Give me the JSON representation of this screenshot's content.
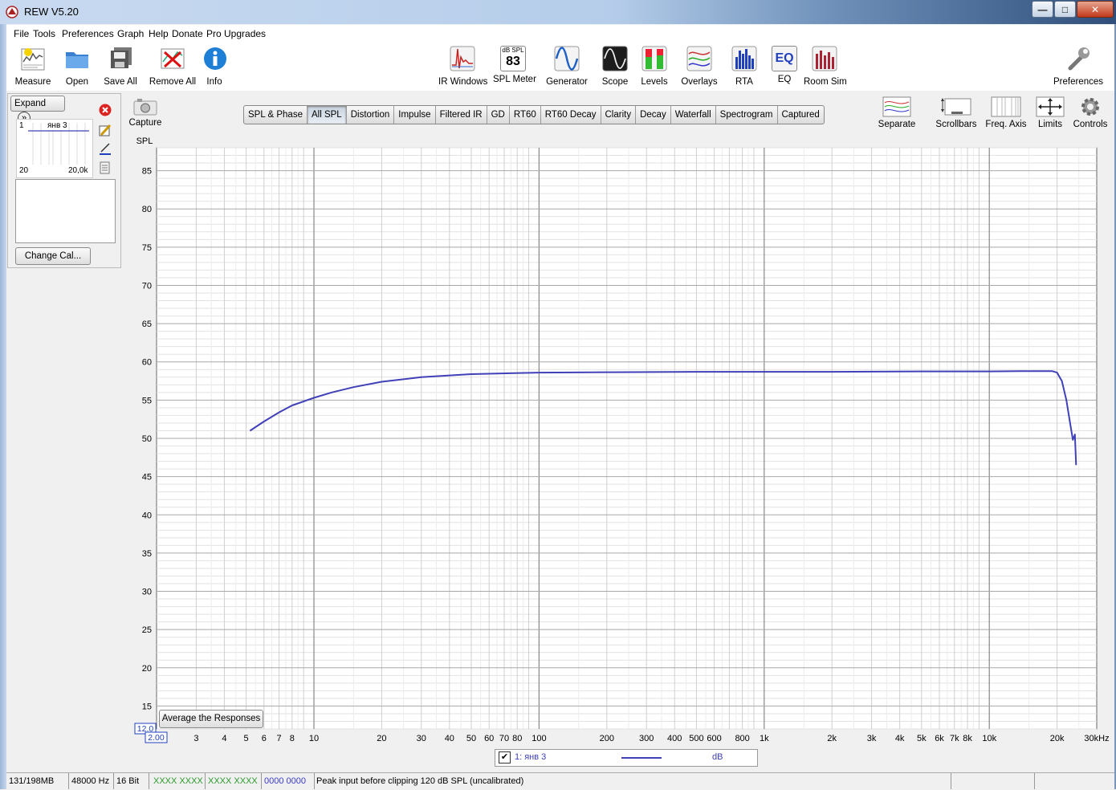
{
  "window": {
    "title": "REW V5.20",
    "minimize_glyph": "—",
    "maximize_glyph": "□",
    "close_glyph": "✕"
  },
  "menu": [
    "File",
    "Tools",
    "Preferences",
    "Graph",
    "Help",
    "Donate",
    "Pro Upgrades"
  ],
  "toolbar_left": [
    {
      "label": "Measure",
      "icon": "measure-icon"
    },
    {
      "label": "Open",
      "icon": "folder-icon"
    },
    {
      "label": "Save All",
      "icon": "save-all-icon"
    },
    {
      "label": "Remove All",
      "icon": "remove-all-icon"
    },
    {
      "label": "Info",
      "icon": "info-icon"
    }
  ],
  "toolbar_center": [
    {
      "label": "IR Windows",
      "icon": "ir-windows-icon"
    },
    {
      "label": "SPL Meter",
      "icon": "spl-meter-icon",
      "top_text": "dB SPL",
      "value": "83"
    },
    {
      "label": "Generator",
      "icon": "generator-icon"
    },
    {
      "label": "Scope",
      "icon": "scope-icon"
    },
    {
      "label": "Levels",
      "icon": "levels-icon"
    },
    {
      "label": "Overlays",
      "icon": "overlays-icon"
    },
    {
      "label": "RTA",
      "icon": "rta-icon"
    },
    {
      "label": "EQ",
      "icon": "eq-icon",
      "text": "EQ"
    },
    {
      "label": "Room Sim",
      "icon": "room-sim-icon"
    }
  ],
  "toolbar_right": {
    "label": "Preferences",
    "icon": "wrench-icon"
  },
  "left_panel": {
    "expand_label": "Expand",
    "expand_glyph": "»",
    "thumb_number": "1",
    "thumb_name": "янв 3",
    "thumb_xmin": "20",
    "thumb_xmax": "20,0k",
    "change_cal_label": "Change Cal..."
  },
  "capture": {
    "label": "Capture"
  },
  "tabs": [
    {
      "label": "SPL & Phase",
      "active": false
    },
    {
      "label": "All SPL",
      "active": true
    },
    {
      "label": "Distortion",
      "active": false
    },
    {
      "label": "Impulse",
      "active": false
    },
    {
      "label": "Filtered IR",
      "active": false
    },
    {
      "label": "GD",
      "active": false
    },
    {
      "label": "RT60",
      "active": false
    },
    {
      "label": "RT60 Decay",
      "active": false
    },
    {
      "label": "Clarity",
      "active": false
    },
    {
      "label": "Decay",
      "active": false
    },
    {
      "label": "Waterfall",
      "active": false
    },
    {
      "label": "Spectrogram",
      "active": false
    },
    {
      "label": "Captured",
      "active": false
    }
  ],
  "graph_controls": [
    {
      "label": "Separate",
      "icon": "separate-icon"
    },
    {
      "label": "Scrollbars",
      "icon": "scrollbars-icon"
    },
    {
      "label": "Freq. Axis",
      "icon": "freq-axis-icon"
    },
    {
      "label": "Limits",
      "icon": "limits-icon"
    },
    {
      "label": "Controls",
      "icon": "controls-gear-icon"
    }
  ],
  "average_button": "Average the Responses",
  "axis_corner": {
    "y_min_box": "12.0",
    "x_min_box": "2.00"
  },
  "legend": {
    "checked": true,
    "check_glyph": "✔",
    "name": "1: янв 3",
    "unit": "dB",
    "color": "#4040b8"
  },
  "status": {
    "memory": "131/198MB",
    "sample_rate": "48000 Hz",
    "bits": "16 Bit",
    "meter_green": "XXXX XXXX   XXXX XXXX",
    "meter_blue": "0000 0000",
    "message": "Peak input before clipping 120 dB SPL (uncalibrated)"
  },
  "chart_data": {
    "type": "line",
    "title": "",
    "ylabel": "SPL",
    "xlabel": "",
    "xscale": "log",
    "xlim": [
      2,
      30000
    ],
    "ylim": [
      12,
      88
    ],
    "grid": true,
    "ytick_values": [
      15,
      20,
      25,
      30,
      35,
      40,
      45,
      50,
      55,
      60,
      65,
      70,
      75,
      80,
      85
    ],
    "xtick_values": [
      3,
      4,
      5,
      6,
      7,
      8,
      10,
      20,
      30,
      40,
      50,
      60,
      70,
      80,
      100,
      200,
      300,
      400,
      500,
      600,
      800,
      1000,
      2000,
      3000,
      4000,
      5000,
      6000,
      7000,
      8000,
      10000,
      20000,
      30000
    ],
    "xtick_labels": [
      "3",
      "4",
      "5",
      "6",
      "7",
      "8",
      "10",
      "20",
      "30",
      "40",
      "50",
      "60",
      "70",
      "80",
      "100",
      "200",
      "300",
      "400",
      "500",
      "600",
      "800",
      "1k",
      "2k",
      "3k",
      "4k",
      "5k",
      "6k",
      "7k",
      "8k",
      "10k",
      "20k",
      "30kHz"
    ],
    "series": [
      {
        "name": "1: янв 3",
        "color": "#4040b8",
        "x": [
          5.2,
          6,
          7,
          8,
          10,
          12,
          15,
          20,
          30,
          50,
          100,
          200,
          500,
          1000,
          2000,
          5000,
          10000,
          15000,
          19000,
          20000,
          21000,
          22000,
          23000,
          23500,
          24000,
          24300
        ],
        "y": [
          51,
          52.2,
          53.4,
          54.3,
          55.3,
          56,
          56.7,
          57.4,
          58,
          58.4,
          58.6,
          58.65,
          58.7,
          58.7,
          58.7,
          58.75,
          58.75,
          58.8,
          58.8,
          58.6,
          57.5,
          55,
          51.5,
          49.8,
          50.5,
          46.5
        ]
      }
    ]
  }
}
